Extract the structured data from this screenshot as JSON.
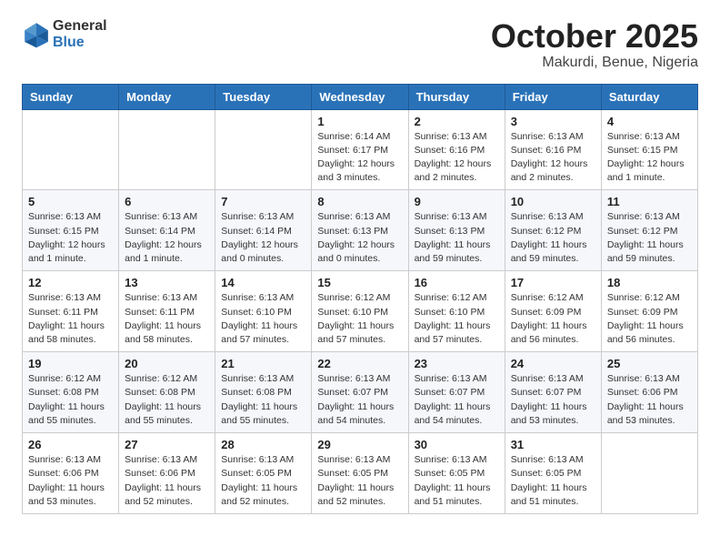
{
  "logo": {
    "general": "General",
    "blue": "Blue"
  },
  "header": {
    "month": "October 2025",
    "location": "Makurdi, Benue, Nigeria"
  },
  "weekdays": [
    "Sunday",
    "Monday",
    "Tuesday",
    "Wednesday",
    "Thursday",
    "Friday",
    "Saturday"
  ],
  "weeks": [
    [
      {
        "day": "",
        "info": ""
      },
      {
        "day": "",
        "info": ""
      },
      {
        "day": "",
        "info": ""
      },
      {
        "day": "1",
        "info": "Sunrise: 6:14 AM\nSunset: 6:17 PM\nDaylight: 12 hours and 3 minutes."
      },
      {
        "day": "2",
        "info": "Sunrise: 6:13 AM\nSunset: 6:16 PM\nDaylight: 12 hours and 2 minutes."
      },
      {
        "day": "3",
        "info": "Sunrise: 6:13 AM\nSunset: 6:16 PM\nDaylight: 12 hours and 2 minutes."
      },
      {
        "day": "4",
        "info": "Sunrise: 6:13 AM\nSunset: 6:15 PM\nDaylight: 12 hours and 1 minute."
      }
    ],
    [
      {
        "day": "5",
        "info": "Sunrise: 6:13 AM\nSunset: 6:15 PM\nDaylight: 12 hours and 1 minute."
      },
      {
        "day": "6",
        "info": "Sunrise: 6:13 AM\nSunset: 6:14 PM\nDaylight: 12 hours and 1 minute."
      },
      {
        "day": "7",
        "info": "Sunrise: 6:13 AM\nSunset: 6:14 PM\nDaylight: 12 hours and 0 minutes."
      },
      {
        "day": "8",
        "info": "Sunrise: 6:13 AM\nSunset: 6:13 PM\nDaylight: 12 hours and 0 minutes."
      },
      {
        "day": "9",
        "info": "Sunrise: 6:13 AM\nSunset: 6:13 PM\nDaylight: 11 hours and 59 minutes."
      },
      {
        "day": "10",
        "info": "Sunrise: 6:13 AM\nSunset: 6:12 PM\nDaylight: 11 hours and 59 minutes."
      },
      {
        "day": "11",
        "info": "Sunrise: 6:13 AM\nSunset: 6:12 PM\nDaylight: 11 hours and 59 minutes."
      }
    ],
    [
      {
        "day": "12",
        "info": "Sunrise: 6:13 AM\nSunset: 6:11 PM\nDaylight: 11 hours and 58 minutes."
      },
      {
        "day": "13",
        "info": "Sunrise: 6:13 AM\nSunset: 6:11 PM\nDaylight: 11 hours and 58 minutes."
      },
      {
        "day": "14",
        "info": "Sunrise: 6:13 AM\nSunset: 6:10 PM\nDaylight: 11 hours and 57 minutes."
      },
      {
        "day": "15",
        "info": "Sunrise: 6:12 AM\nSunset: 6:10 PM\nDaylight: 11 hours and 57 minutes."
      },
      {
        "day": "16",
        "info": "Sunrise: 6:12 AM\nSunset: 6:10 PM\nDaylight: 11 hours and 57 minutes."
      },
      {
        "day": "17",
        "info": "Sunrise: 6:12 AM\nSunset: 6:09 PM\nDaylight: 11 hours and 56 minutes."
      },
      {
        "day": "18",
        "info": "Sunrise: 6:12 AM\nSunset: 6:09 PM\nDaylight: 11 hours and 56 minutes."
      }
    ],
    [
      {
        "day": "19",
        "info": "Sunrise: 6:12 AM\nSunset: 6:08 PM\nDaylight: 11 hours and 55 minutes."
      },
      {
        "day": "20",
        "info": "Sunrise: 6:12 AM\nSunset: 6:08 PM\nDaylight: 11 hours and 55 minutes."
      },
      {
        "day": "21",
        "info": "Sunrise: 6:13 AM\nSunset: 6:08 PM\nDaylight: 11 hours and 55 minutes."
      },
      {
        "day": "22",
        "info": "Sunrise: 6:13 AM\nSunset: 6:07 PM\nDaylight: 11 hours and 54 minutes."
      },
      {
        "day": "23",
        "info": "Sunrise: 6:13 AM\nSunset: 6:07 PM\nDaylight: 11 hours and 54 minutes."
      },
      {
        "day": "24",
        "info": "Sunrise: 6:13 AM\nSunset: 6:07 PM\nDaylight: 11 hours and 53 minutes."
      },
      {
        "day": "25",
        "info": "Sunrise: 6:13 AM\nSunset: 6:06 PM\nDaylight: 11 hours and 53 minutes."
      }
    ],
    [
      {
        "day": "26",
        "info": "Sunrise: 6:13 AM\nSunset: 6:06 PM\nDaylight: 11 hours and 53 minutes."
      },
      {
        "day": "27",
        "info": "Sunrise: 6:13 AM\nSunset: 6:06 PM\nDaylight: 11 hours and 52 minutes."
      },
      {
        "day": "28",
        "info": "Sunrise: 6:13 AM\nSunset: 6:05 PM\nDaylight: 11 hours and 52 minutes."
      },
      {
        "day": "29",
        "info": "Sunrise: 6:13 AM\nSunset: 6:05 PM\nDaylight: 11 hours and 52 minutes."
      },
      {
        "day": "30",
        "info": "Sunrise: 6:13 AM\nSunset: 6:05 PM\nDaylight: 11 hours and 51 minutes."
      },
      {
        "day": "31",
        "info": "Sunrise: 6:13 AM\nSunset: 6:05 PM\nDaylight: 11 hours and 51 minutes."
      },
      {
        "day": "",
        "info": ""
      }
    ]
  ]
}
